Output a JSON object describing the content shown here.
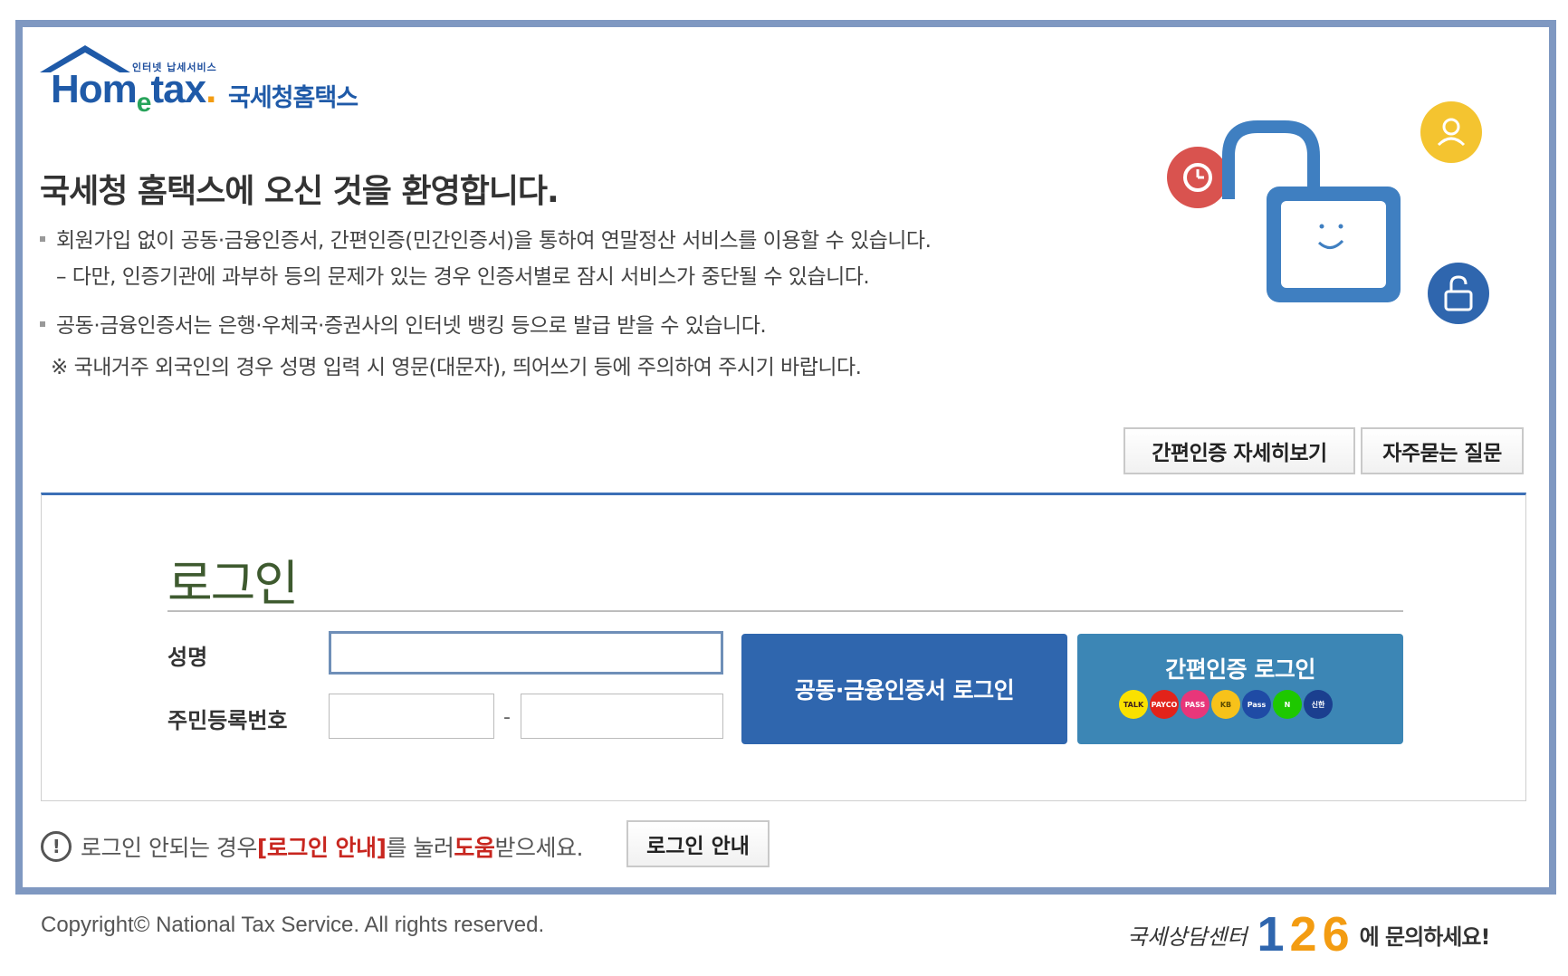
{
  "logo": {
    "tagline": "인터넷 납세서비스",
    "brand_home": "Hom",
    "brand_e": "e",
    "brand_tax": "tax",
    "brand_dot": ".",
    "brand_kr": "국세청홈택스"
  },
  "welcome": {
    "title": "국세청 홈택스에 오신 것을 환영합니다."
  },
  "notices": [
    "회원가입 없이 공동·금융인증서, 간편인증(민간인증서)을 통하여 연말정산 서비스를 이용할 수 있습니다.",
    "– 다만, 인증기관에 과부하 등의 문제가 있는 경우 인증서별로 잠시 서비스가 중단될 수 있습니다.",
    "공동·금융인증서는 은행·우체국·증권사의 인터넷 뱅킹 등으로 발급 받을 수 있습니다.",
    "※ 국내거주 외국인의 경우 성명 입력 시 영문(대문자), 띄어쓰기 등에 주의하여 주시기 바랍니다."
  ],
  "top_buttons": {
    "simple_auth_detail": "간편인증 자세히보기",
    "faq": "자주묻는 질문"
  },
  "login": {
    "title": "로그인",
    "name_label": "성명",
    "rrn_label": "주민등록번호",
    "rrn_separator": "-",
    "name_value": "",
    "rrn_front_value": "",
    "rrn_back_value": "",
    "cert_login_button": "공동·금융인증서 로그인",
    "simple_login_button": "간편인증 로그인",
    "providers": [
      {
        "name": "kakao",
        "text": "TALK",
        "bg": "#fae100",
        "fg": "#3c1e1e"
      },
      {
        "name": "payco",
        "text": "PAYCO",
        "bg": "#e2231a",
        "fg": "#ffffff"
      },
      {
        "name": "pass",
        "text": "PASS",
        "bg": "#e8367a",
        "fg": "#ffffff"
      },
      {
        "name": "kb",
        "text": "KB",
        "bg": "#f7c21a",
        "fg": "#5a4a00"
      },
      {
        "name": "samsung-pass",
        "text": "Pass",
        "bg": "#1f4ba5",
        "fg": "#ffffff"
      },
      {
        "name": "naver",
        "text": "N",
        "bg": "#1ec800",
        "fg": "#ffffff"
      },
      {
        "name": "shinhan",
        "text": "신한",
        "bg": "#1b3f8f",
        "fg": "#ffffff"
      }
    ]
  },
  "help": {
    "icon": "!",
    "text_before": "로그인 안되는 경우 ",
    "highlight_1": "[로그인 안내]",
    "text_middle": "를 눌러 ",
    "highlight_2": "도움",
    "text_after": "받으세요.",
    "button": "로그인 안내"
  },
  "footer": {
    "copyright": "Copyright© National Tax Service. All rights reserved.",
    "callcenter_label": "국세상담센터",
    "callcenter_digits": [
      "1",
      "2",
      "6"
    ],
    "callcenter_tail": "에 문의하세요!"
  },
  "colors": {
    "frame": "#7f98c1",
    "primary_blue": "#2f66ae",
    "simple_blue": "#3c86b5",
    "login_title_green": "#3e5a2f",
    "highlight_red": "#c8261f",
    "digit_1": "#2f66ae",
    "digit_2": "#f39c12",
    "digit_6": "#f39c12"
  }
}
